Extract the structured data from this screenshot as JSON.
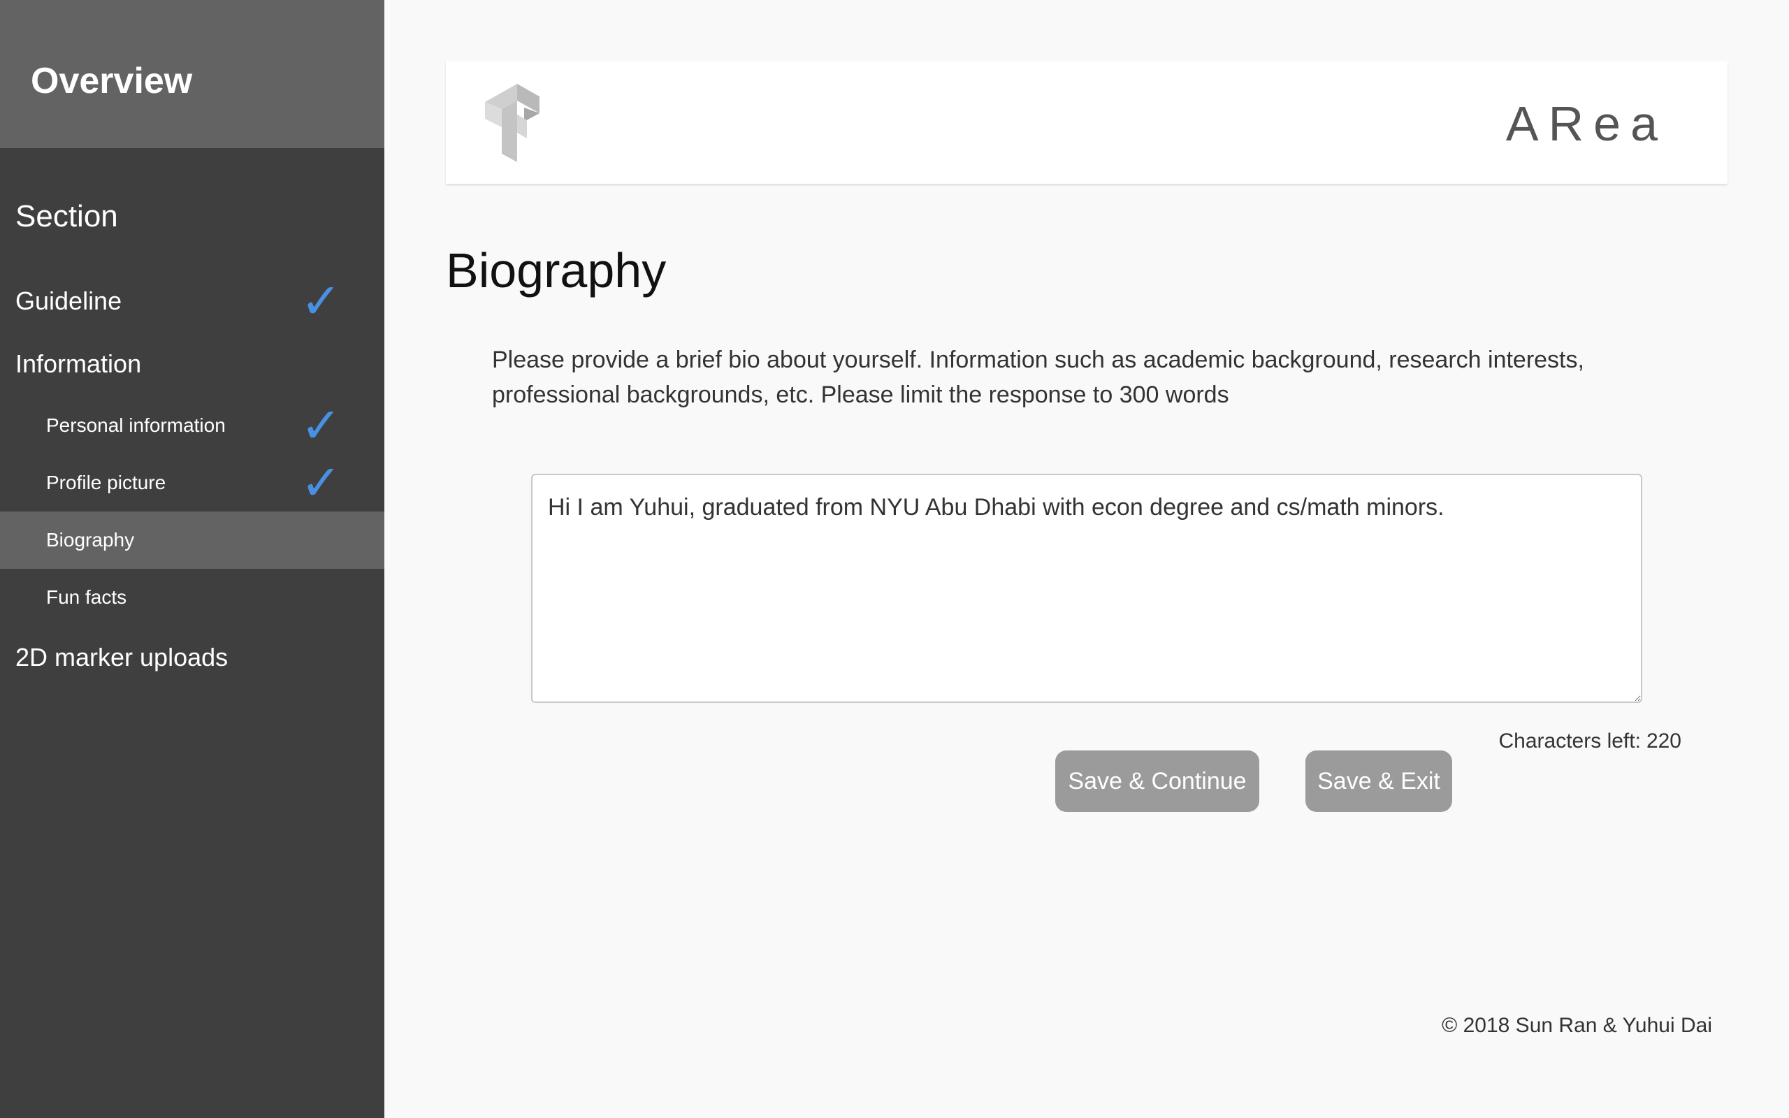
{
  "sidebar": {
    "title": "Overview",
    "section_title": "Section",
    "items": [
      {
        "label": "Guideline",
        "check": "✓"
      },
      {
        "label": "Information"
      },
      {
        "label": "Personal information",
        "check": "✓"
      },
      {
        "label": "Profile picture",
        "check": "✓"
      },
      {
        "label": "Biography",
        "active": true
      },
      {
        "label": "Fun facts"
      },
      {
        "label": "2D marker uploads"
      }
    ]
  },
  "header": {
    "logo_icon": "tensorflow-style-logo-icon",
    "brand": "ARea"
  },
  "main": {
    "title": "Biography",
    "instructions": "Please provide a brief bio about yourself. Information such as academic background, research interests, professional backgrounds, etc. Please limit the response to 300 words",
    "bio_value": "Hi I am Yuhui, graduated from NYU Abu Dhabi with econ degree and cs/math minors.",
    "chars_left_label": "Characters left:",
    "chars_left_value": "220",
    "save_continue_label": "Save & Continue",
    "save_exit_label": "Save & Exit"
  },
  "footer": {
    "copyright": "© 2018 Sun Ran & Yuhui Dai"
  },
  "colors": {
    "sidebar_bg": "#3f3f3f",
    "sidebar_header_bg": "#636363",
    "check_color": "#4a90e2",
    "button_bg": "#9b9b9b",
    "page_bg": "#f9f9f9"
  }
}
